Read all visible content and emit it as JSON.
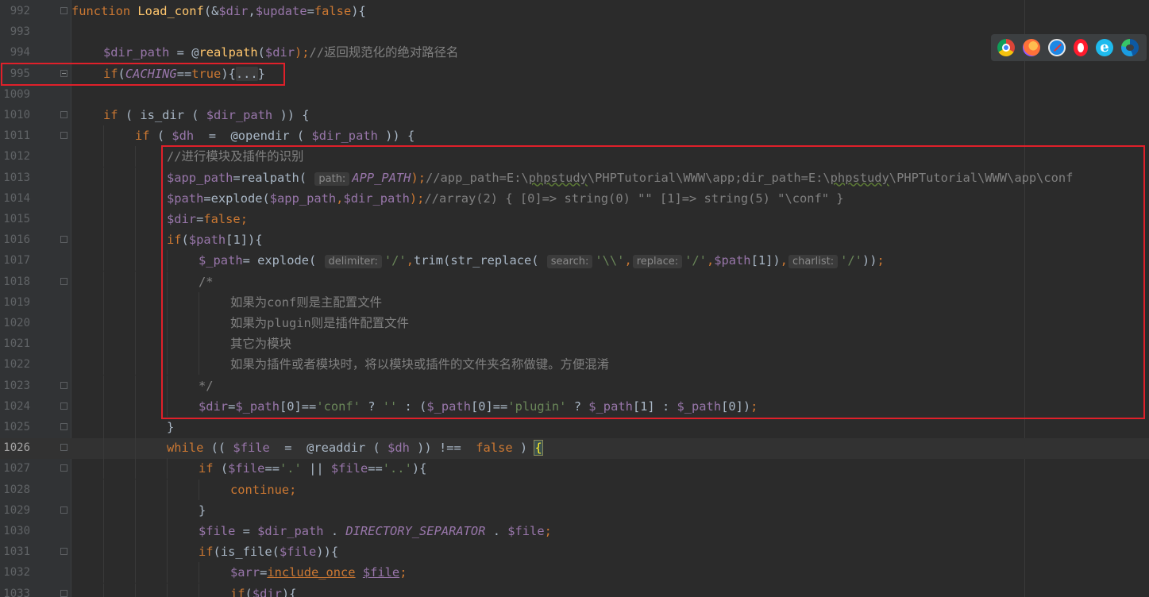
{
  "browser_icons": [
    "chrome-icon",
    "firefox-icon",
    "safari-icon",
    "opera-icon",
    "ie-icon",
    "edge-icon"
  ],
  "ie_glyph": "e",
  "lines": [
    {
      "num": "992",
      "indent": 0,
      "fold": "minus",
      "tokens": [
        [
          "kw",
          "function "
        ],
        [
          "fn",
          "Load_conf"
        ],
        [
          "",
          "(&"
        ],
        [
          "var",
          "$dir"
        ],
        [
          "",
          ","
        ],
        [
          "var",
          "$update"
        ],
        [
          "",
          "="
        ],
        [
          "kw",
          "false"
        ],
        [
          "",
          "){"
        ]
      ]
    },
    {
      "num": "993",
      "indent": 0,
      "tokens": []
    },
    {
      "num": "994",
      "indent": 1,
      "tokens": [
        [
          "var",
          "$dir_path"
        ],
        [
          "",
          " = "
        ],
        [
          "",
          "@"
        ],
        [
          "fn",
          "realpath"
        ],
        [
          "",
          "("
        ],
        [
          "var",
          "$dir"
        ],
        [
          "kw",
          ");"
        ],
        [
          "cmt",
          "//返回规范化的绝对路径名"
        ]
      ]
    },
    {
      "num": "995",
      "indent": 1,
      "fold": "plus",
      "tokens": [
        [
          "kw",
          "if"
        ],
        [
          "",
          "("
        ],
        [
          "const",
          "CACHING"
        ],
        [
          "",
          "=="
        ],
        [
          "kw",
          "true"
        ],
        [
          "",
          "){"
        ],
        [
          "foldbox",
          "..."
        ],
        [
          "",
          "}"
        ]
      ]
    },
    {
      "num": "1009",
      "indent": 0,
      "tokens": []
    },
    {
      "num": "1010",
      "indent": 1,
      "fold": "minus",
      "tokens": [
        [
          "kw",
          "if"
        ],
        [
          "",
          " ( "
        ],
        [
          "",
          "is_dir"
        ],
        [
          "",
          " ( "
        ],
        [
          "var",
          "$dir_path"
        ],
        [
          "",
          " )) {"
        ]
      ]
    },
    {
      "num": "1011",
      "indent": 2,
      "fold": "minus",
      "tokens": [
        [
          "kw",
          "if"
        ],
        [
          "",
          " ( "
        ],
        [
          "var",
          "$dh"
        ],
        [
          "",
          "  =  "
        ],
        [
          "",
          "@opendir"
        ],
        [
          "",
          " ( "
        ],
        [
          "var",
          "$dir_path"
        ],
        [
          "",
          " )) {"
        ]
      ]
    },
    {
      "num": "1012",
      "indent": 3,
      "tokens": [
        [
          "cmt",
          "//进行模块及插件的识别"
        ]
      ]
    },
    {
      "num": "1013",
      "indent": 3,
      "tokens": [
        [
          "var",
          "$app_path"
        ],
        [
          "",
          "="
        ],
        [
          "",
          "realpath"
        ],
        [
          "",
          "( "
        ],
        [
          "hint",
          "path:"
        ],
        [
          "const",
          "APP_PATH"
        ],
        [
          "kw",
          ");"
        ],
        [
          "cmt",
          "//app_path=E:\\"
        ],
        [
          "cmtw",
          "phpstudy"
        ],
        [
          "cmt",
          "\\PHPTutorial\\WWW\\app;dir_path=E:\\"
        ],
        [
          "cmtw",
          "phpstudy"
        ],
        [
          "cmt",
          "\\PHPTutorial\\WWW\\app\\conf"
        ]
      ]
    },
    {
      "num": "1014",
      "indent": 3,
      "tokens": [
        [
          "var",
          "$path"
        ],
        [
          "",
          "="
        ],
        [
          "",
          "explode("
        ],
        [
          "var",
          "$app_path"
        ],
        [
          "kw",
          ","
        ],
        [
          "var",
          "$dir_path"
        ],
        [
          "kw",
          ");"
        ],
        [
          "cmt",
          "//array(2) { [0]=> string(0) \"\" [1]=> string(5) \"\\conf\" }"
        ]
      ]
    },
    {
      "num": "1015",
      "indent": 3,
      "tokens": [
        [
          "var",
          "$dir"
        ],
        [
          "",
          "="
        ],
        [
          "kw",
          "false;"
        ]
      ]
    },
    {
      "num": "1016",
      "indent": 3,
      "fold": "minus",
      "tokens": [
        [
          "kw",
          "if"
        ],
        [
          "",
          "("
        ],
        [
          "var",
          "$path"
        ],
        [
          "",
          "[1]){"
        ]
      ]
    },
    {
      "num": "1017",
      "indent": 4,
      "tokens": [
        [
          "var",
          "$_path"
        ],
        [
          "",
          "= explode( "
        ],
        [
          "hint",
          "delimiter:"
        ],
        [
          "str",
          "'/'"
        ],
        [
          "kw",
          ","
        ],
        [
          "",
          "trim(str_replace( "
        ],
        [
          "hint",
          "search:"
        ],
        [
          "str",
          "'\\\\'"
        ],
        [
          "kw",
          ","
        ],
        [
          "hint",
          "replace:"
        ],
        [
          "str",
          "'/'"
        ],
        [
          "kw",
          ","
        ],
        [
          "var",
          "$path"
        ],
        [
          "",
          "[1])"
        ],
        [
          "kw",
          ","
        ],
        [
          "hint",
          "charlist:"
        ],
        [
          "str",
          "'/'"
        ],
        [
          "",
          "))"
        ],
        [
          "kw",
          ";"
        ]
      ]
    },
    {
      "num": "1018",
      "indent": 4,
      "fold": "minus",
      "tokens": [
        [
          "cmt",
          "/*"
        ]
      ]
    },
    {
      "num": "1019",
      "indent": 5,
      "tokens": [
        [
          "cmt",
          "如果为conf则是主配置文件"
        ]
      ]
    },
    {
      "num": "1020",
      "indent": 5,
      "tokens": [
        [
          "cmt",
          "如果为plugin则是插件配置文件"
        ]
      ]
    },
    {
      "num": "1021",
      "indent": 5,
      "tokens": [
        [
          "cmt",
          "其它为模块"
        ]
      ]
    },
    {
      "num": "1022",
      "indent": 5,
      "tokens": [
        [
          "cmt",
          "如果为插件或者模块时，将以模块或插件的文件夹名称做键。方便混淆"
        ]
      ]
    },
    {
      "num": "1023",
      "indent": 4,
      "fold": "minus",
      "tokens": [
        [
          "cmt",
          "*/"
        ]
      ]
    },
    {
      "num": "1024",
      "indent": 4,
      "fold": "minus",
      "tokens": [
        [
          "var",
          "$dir"
        ],
        [
          "",
          "="
        ],
        [
          "var",
          "$_path"
        ],
        [
          "",
          "[0]=="
        ],
        [
          "str",
          "'conf'"
        ],
        [
          "",
          " ? "
        ],
        [
          "str",
          "''"
        ],
        [
          "",
          " : ("
        ],
        [
          "var",
          "$_path"
        ],
        [
          "",
          "[0]=="
        ],
        [
          "str",
          "'plugin'"
        ],
        [
          "",
          " ? "
        ],
        [
          "var",
          "$_path"
        ],
        [
          "",
          "[1] : "
        ],
        [
          "var",
          "$_path"
        ],
        [
          "",
          "[0])"
        ],
        [
          "kw",
          ";"
        ]
      ]
    },
    {
      "num": "1025",
      "indent": 3,
      "fold": "minus",
      "tokens": [
        [
          "",
          "}"
        ]
      ]
    },
    {
      "num": "1026",
      "indent": 3,
      "fold": "minus",
      "current": true,
      "tokens": [
        [
          "kw",
          "while"
        ],
        [
          "",
          " (( "
        ],
        [
          "var",
          "$file"
        ],
        [
          "",
          "  =  "
        ],
        [
          "",
          "@readdir"
        ],
        [
          "",
          " ( "
        ],
        [
          "var",
          "$dh"
        ],
        [
          "",
          " )) !==  "
        ],
        [
          "kw",
          "false"
        ],
        [
          "",
          " ) "
        ],
        [
          "brace",
          "{"
        ]
      ]
    },
    {
      "num": "1027",
      "indent": 4,
      "fold": "minus",
      "tokens": [
        [
          "kw",
          "if"
        ],
        [
          "",
          " ("
        ],
        [
          "var",
          "$file"
        ],
        [
          "",
          "=="
        ],
        [
          "str",
          "'.'"
        ],
        [
          "",
          " || "
        ],
        [
          "var",
          "$file"
        ],
        [
          "",
          "=="
        ],
        [
          "str",
          "'..'"
        ],
        [
          "",
          "){"
        ]
      ]
    },
    {
      "num": "1028",
      "indent": 5,
      "tokens": [
        [
          "kw",
          "continue;"
        ]
      ]
    },
    {
      "num": "1029",
      "indent": 4,
      "fold": "minus",
      "tokens": [
        [
          "",
          "}"
        ]
      ]
    },
    {
      "num": "1030",
      "indent": 4,
      "tokens": [
        [
          "var",
          "$file"
        ],
        [
          "",
          " = "
        ],
        [
          "var",
          "$dir_path"
        ],
        [
          "",
          " . "
        ],
        [
          "const",
          "DIRECTORY_SEPARATOR"
        ],
        [
          "",
          " . "
        ],
        [
          "var",
          "$file"
        ],
        [
          "kw",
          ";"
        ]
      ]
    },
    {
      "num": "1031",
      "indent": 4,
      "fold": "minus",
      "tokens": [
        [
          "kw",
          "if"
        ],
        [
          "",
          "(is_file("
        ],
        [
          "var",
          "$file"
        ],
        [
          "",
          "))"
        ],
        [
          "",
          "{"
        ]
      ]
    },
    {
      "num": "1032",
      "indent": 5,
      "tokens": [
        [
          "var",
          "$arr"
        ],
        [
          "",
          "="
        ],
        [
          "kwu",
          "include_once"
        ],
        [
          "",
          " "
        ],
        [
          "varu",
          "$file"
        ],
        [
          "kw",
          ";"
        ]
      ]
    },
    {
      "num": "1033",
      "indent": 5,
      "fold": "minus",
      "tokens": [
        [
          "kw",
          "if"
        ],
        [
          "",
          "("
        ],
        [
          "var",
          "$dir"
        ],
        [
          "",
          "){"
        ]
      ]
    }
  ]
}
